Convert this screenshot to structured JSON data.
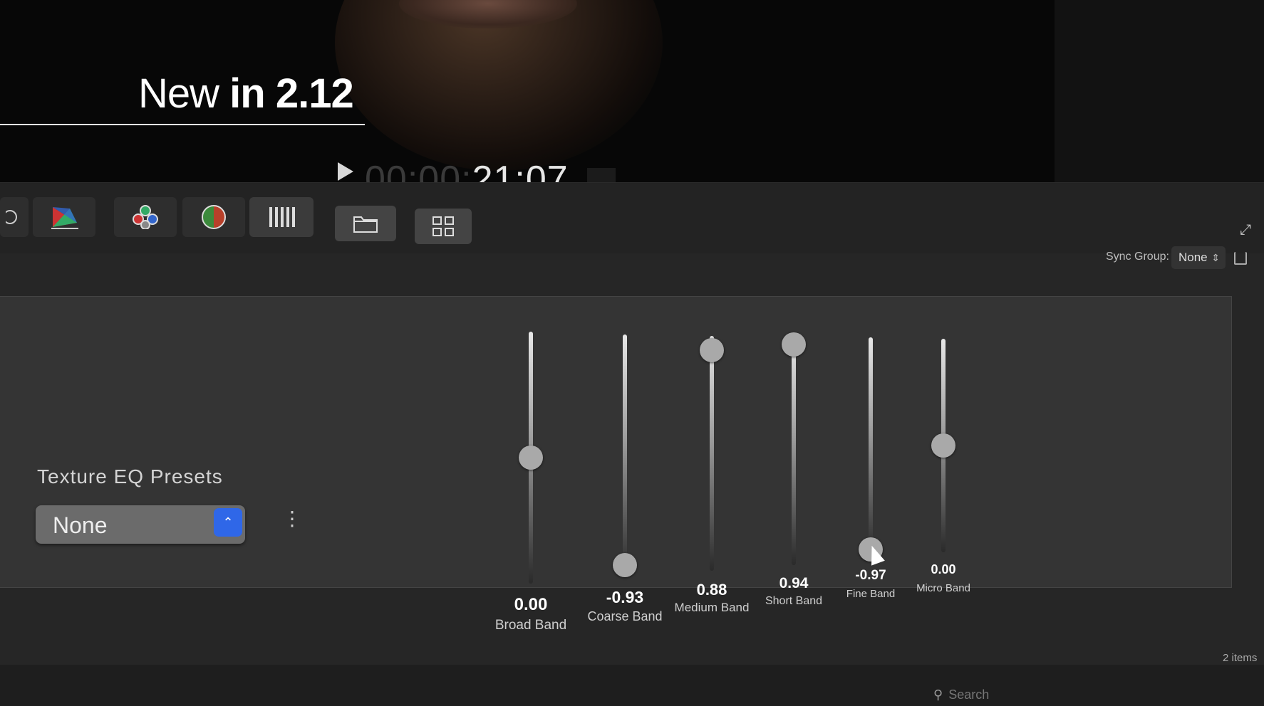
{
  "overlay": {
    "headline_light": "New",
    "headline_bold_in": "in",
    "headline_bold_version": "2.12"
  },
  "viewer": {
    "timecode_dim": "00:00:",
    "timecode_bright": "21:07"
  },
  "toolbar": {
    "tools": [
      "color-wheel-icon",
      "color-board-icon",
      "color-curves-icon",
      "hue-saturation-icon",
      "waveform-icon"
    ],
    "buttons": [
      "folder-icon",
      "grid-icon"
    ]
  },
  "inspector": {
    "sync_group_label": "Sync Group:",
    "sync_group_value": "None",
    "presets_title": "Texture EQ Presets",
    "preset_value": "None"
  },
  "sliders": [
    {
      "name": "Broad Band",
      "value": "0.00",
      "level": 0.5
    },
    {
      "name": "Coarse Band",
      "value": "-0.93",
      "level": 0.04
    },
    {
      "name": "Medium Band",
      "value": "0.88",
      "level": 0.94
    },
    {
      "name": "Short Band",
      "value": "0.94",
      "level": 0.97
    },
    {
      "name": "Fine Band",
      "value": "-0.97",
      "level": 0.02
    },
    {
      "name": "Micro Band",
      "value": "0.00",
      "level": 0.5
    }
  ],
  "footer": {
    "item_count": "2 items",
    "search_placeholder": "Search"
  },
  "colors": {
    "accent": "#2f67e8",
    "panel": "#343434",
    "background": "#262626"
  }
}
